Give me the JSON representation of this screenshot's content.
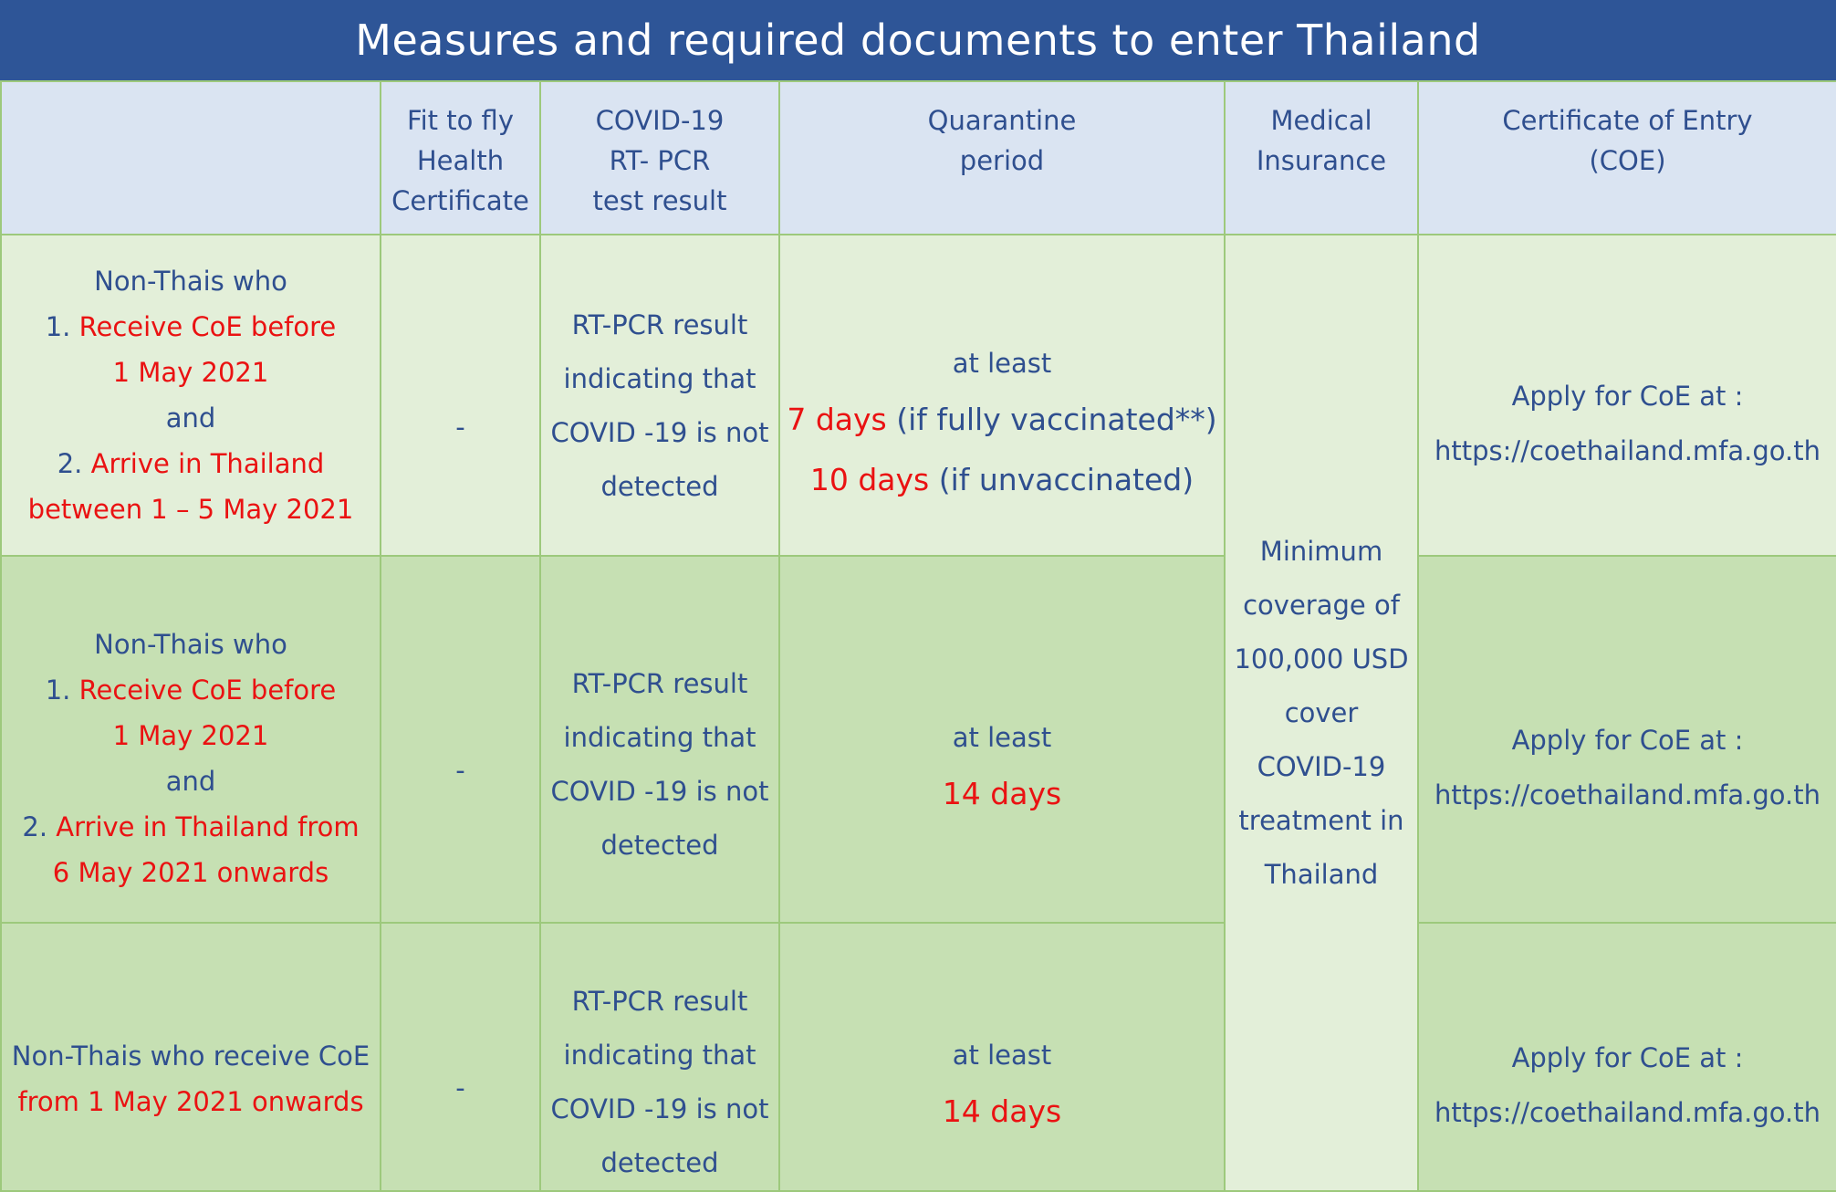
{
  "title": "Measures and required documents to enter Thailand",
  "header": {
    "fit_to_fly": [
      "Fit to fly",
      "Health",
      "Certificate"
    ],
    "pcr": [
      "COVID-19",
      "RT- PCR",
      "test result"
    ],
    "quarantine": [
      "Quarantine",
      "period"
    ],
    "insurance": [
      "Medical",
      "Insurance"
    ],
    "coe": [
      "Certificate of Entry",
      "(COE)"
    ]
  },
  "rows": [
    {
      "group": {
        "l1": "Non-Thais who",
        "l2_num": "1. ",
        "l2_text": "Receive CoE before",
        "l3": "1 May 2021",
        "l4": "and",
        "l5_num": "2. ",
        "l5_text": "Arrive in Thailand",
        "l6": "between 1 – 5 May 2021"
      },
      "fit_to_fly": "-",
      "pcr": [
        "RT-PCR result",
        "indicating that",
        "COVID -19 is not",
        "detected"
      ],
      "quarantine": {
        "at_least": "at least",
        "a_days": "7 days",
        "a_note": " (if fully vaccinated**)",
        "b_days": "10 days",
        "b_note": " (if unvaccinated)"
      },
      "coe": [
        "Apply for CoE at :",
        "https://coethailand.mfa.go.th"
      ]
    },
    {
      "group": {
        "l1": "Non-Thais who",
        "l2_num": "1. ",
        "l2_text": "Receive CoE before",
        "l3": "1 May 2021",
        "l4": "and",
        "l5_num": "2. ",
        "l5_text": "Arrive in Thailand from",
        "l6": "6 May 2021 onwards"
      },
      "fit_to_fly": "-",
      "pcr": [
        "RT-PCR result",
        "indicating that",
        "COVID -19 is not",
        "detected"
      ],
      "quarantine": {
        "at_least": "at least",
        "days": "14 days"
      },
      "coe": [
        "Apply for CoE at :",
        "https://coethailand.mfa.go.th"
      ]
    },
    {
      "group": {
        "l1": "Non-Thais who receive CoE",
        "l2": "from 1 May 2021 onwards"
      },
      "fit_to_fly": "-",
      "pcr": [
        "RT-PCR result",
        "indicating that",
        "COVID -19 is not",
        "detected"
      ],
      "quarantine": {
        "at_least": "at least",
        "days": "14 days"
      },
      "coe": [
        "Apply for CoE at :",
        "https://coethailand.mfa.go.th"
      ]
    }
  ],
  "insurance": [
    "Minimum",
    "coverage of",
    "100,000 USD",
    "cover",
    "COVID-19",
    "treatment in",
    "Thailand"
  ],
  "colors": {
    "title_bg": "#2e5597",
    "header_bg": "#dae4f2",
    "row_light": "#e3efd9",
    "row_dark": "#c6e0b3",
    "border": "#9dc97c",
    "text_blue": "#2f4f8f",
    "text_red": "#ea1212"
  }
}
